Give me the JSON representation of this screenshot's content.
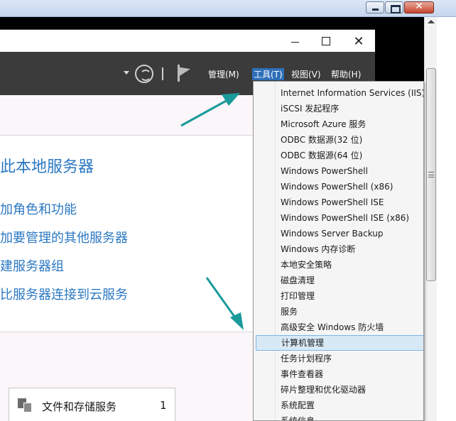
{
  "server_manager": {
    "menus": [
      {
        "label": "管理(M)"
      },
      {
        "label": "工具(T)"
      },
      {
        "label": "视图(V)"
      },
      {
        "label": "帮助(H)"
      }
    ]
  },
  "content": {
    "heading": "此本地服务器",
    "links": [
      {
        "label": "加角色和功能"
      },
      {
        "label": "加要管理的其他服务器"
      },
      {
        "label": "建服务器组"
      },
      {
        "label": "比服务器连接到云服务"
      }
    ],
    "tile": {
      "label": "文件和存储服务",
      "count": "1"
    }
  },
  "tools_menu": {
    "items": [
      {
        "label": "Internet Information Services (IIS)管"
      },
      {
        "label": "iSCSI 发起程序"
      },
      {
        "label": "Microsoft Azure 服务"
      },
      {
        "label": "ODBC 数据源(32 位)"
      },
      {
        "label": "ODBC 数据源(64 位)"
      },
      {
        "label": "Windows PowerShell"
      },
      {
        "label": "Windows PowerShell (x86)"
      },
      {
        "label": "Windows PowerShell ISE"
      },
      {
        "label": "Windows PowerShell ISE (x86)"
      },
      {
        "label": "Windows Server Backup"
      },
      {
        "label": "Windows 内存诊断"
      },
      {
        "label": "本地安全策略"
      },
      {
        "label": "磁盘清理"
      },
      {
        "label": "打印管理"
      },
      {
        "label": "服务"
      },
      {
        "label": "高级安全 Windows 防火墙"
      },
      {
        "label": "计算机管理"
      },
      {
        "label": "任务计划程序"
      },
      {
        "label": "事件查看器"
      },
      {
        "label": "碎片整理和优化驱动器"
      },
      {
        "label": "系统配置"
      },
      {
        "label": "系统信息"
      }
    ],
    "selected_index": 16
  },
  "colors": {
    "accent": "#2b78c2",
    "header_bg": "#3b3b3b",
    "annotation_arrow": "#1a9a9a"
  }
}
